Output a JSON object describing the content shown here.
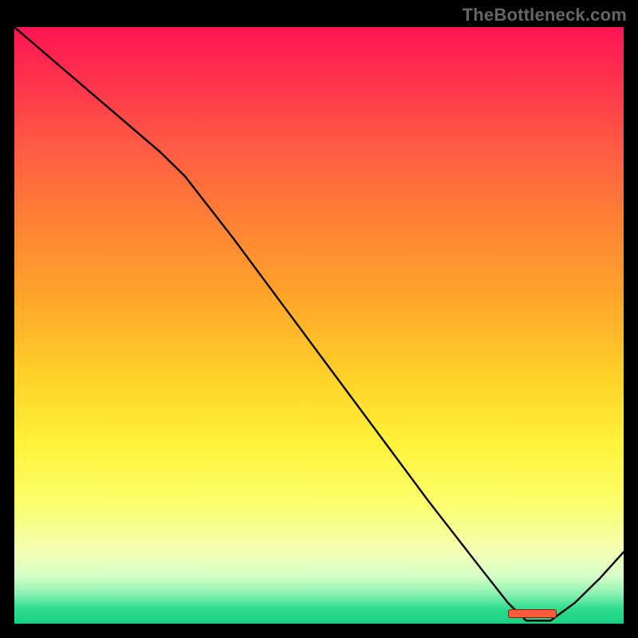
{
  "watermark": "TheBottleneck.com",
  "chart_data": {
    "type": "line",
    "title": "",
    "xlabel": "",
    "ylabel": "",
    "xlim": [
      0,
      100
    ],
    "ylim": [
      0,
      100
    ],
    "series": [
      {
        "name": "bottleneck-curve",
        "x": [
          0,
          8,
          16,
          24,
          28,
          36,
          44,
          52,
          60,
          68,
          76,
          81,
          84,
          88,
          92,
          96,
          100
        ],
        "y": [
          100,
          93,
          86,
          79,
          75,
          64.5,
          53.5,
          42.5,
          31.5,
          20.5,
          10,
          3.5,
          0.5,
          0.5,
          3.5,
          7.5,
          12
        ]
      }
    ],
    "trough": {
      "x_start": 81,
      "x_end": 89,
      "label": ""
    },
    "gradient_meaning": "vertical rainbow from red (top / high bottleneck) to green (bottom / low bottleneck)"
  }
}
